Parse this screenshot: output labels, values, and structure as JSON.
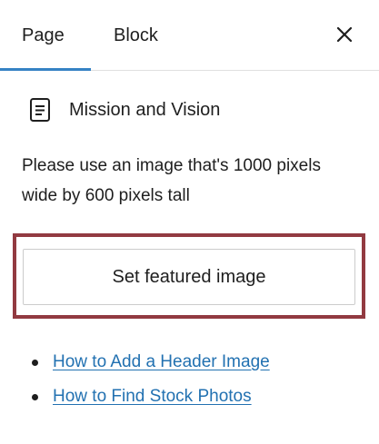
{
  "tabs": [
    {
      "label": "Page",
      "active": true
    },
    {
      "label": "Block",
      "active": false
    }
  ],
  "close_icon": "close-icon",
  "post": {
    "icon": "document-icon",
    "title": "Mission and Vision"
  },
  "featured_image": {
    "instruction": "Please use an image that's 1000 pixels wide by 600 pixels tall",
    "button_label": "Set featured image"
  },
  "help_links": [
    {
      "label": "How to Add a Header Image"
    },
    {
      "label": "How to Find Stock Photos"
    }
  ],
  "colors": {
    "accent": "#3582c4",
    "link": "#2271b1",
    "highlight_frame": "#923a41",
    "text": "#1e1e1e"
  }
}
